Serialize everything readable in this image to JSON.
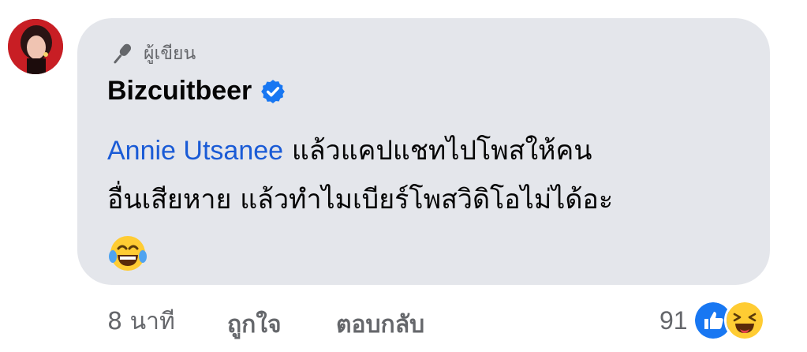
{
  "comment": {
    "author_badge": "ผู้เขียน",
    "author_name": "Bizcuitbeer",
    "mention": "Annie Utsanee",
    "text_line1": " แล้วแคปแชทไปโพสให้คน",
    "text_line2": "อื่นเสียหาย แล้วทำไมเบียร์โพสวิดิโอไม่ได้อะ",
    "emoji": "laughing-crying-emoji"
  },
  "actions": {
    "time": "8 นาที",
    "like_label": "ถูกใจ",
    "reply_label": "ตอบกลับ"
  },
  "reactions": {
    "count": "91",
    "types": [
      "like",
      "haha"
    ]
  },
  "colors": {
    "bubble": "#e4e6eb",
    "mention": "#1a5bd6",
    "verified": "#1877f2",
    "muted": "#65676b"
  }
}
